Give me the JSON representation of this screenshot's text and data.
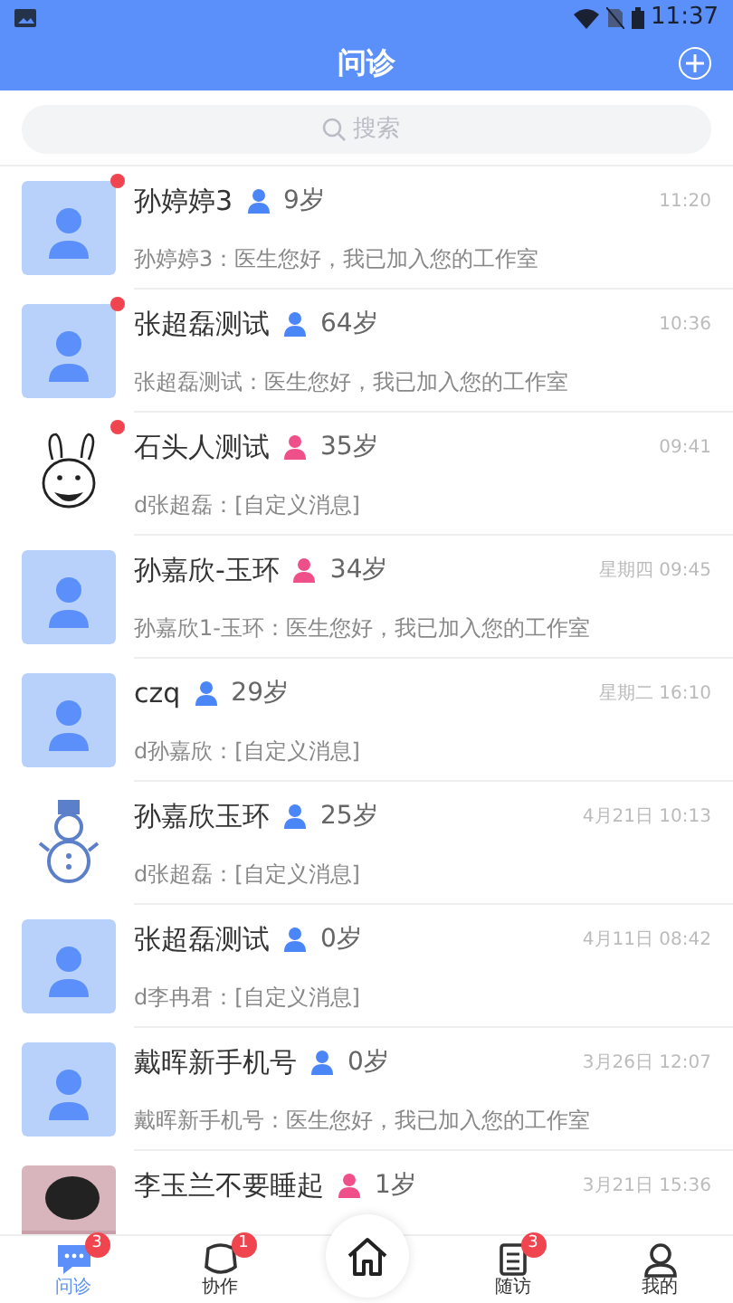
{
  "status_bar": {
    "time": "11:37"
  },
  "header": {
    "title": "问诊"
  },
  "search": {
    "placeholder": "搜索"
  },
  "conversations": [
    {
      "name": "孙婷婷3",
      "female": false,
      "age": "9岁",
      "time": "11:20",
      "message": "孙婷婷3：医生您好，我已加入您的工作室",
      "unread": true,
      "avatar": {
        "kind": "default"
      }
    },
    {
      "name": "张超磊测试",
      "female": false,
      "age": "64岁",
      "time": "10:36",
      "message": "张超磊测试：医生您好，我已加入您的工作室",
      "unread": true,
      "avatar": {
        "kind": "default"
      }
    },
    {
      "name": "石头人测试",
      "female": true,
      "age": "35岁",
      "time": "09:41",
      "message": "d张超磊：[自定义消息]",
      "unread": true,
      "avatar": {
        "kind": "cartoon"
      }
    },
    {
      "name": "孙嘉欣-玉环",
      "female": true,
      "age": "34岁",
      "time": "星期四 09:45",
      "message": "孙嘉欣1-玉环：医生您好，我已加入您的工作室",
      "unread": false,
      "avatar": {
        "kind": "default"
      }
    },
    {
      "name": "czq",
      "female": false,
      "age": "29岁",
      "time": "星期二 16:10",
      "message": "d孙嘉欣：[自定义消息]",
      "unread": false,
      "avatar": {
        "kind": "default"
      }
    },
    {
      "name": "孙嘉欣玉环",
      "female": false,
      "age": "25岁",
      "time": "4月21日 10:13",
      "message": "d张超磊：[自定义消息]",
      "unread": false,
      "avatar": {
        "kind": "snowman"
      }
    },
    {
      "name": "张超磊测试",
      "female": false,
      "age": "0岁",
      "time": "4月11日 08:42",
      "message": "d李冉君：[自定义消息]",
      "unread": false,
      "avatar": {
        "kind": "default"
      }
    },
    {
      "name": "戴晖新手机号",
      "female": false,
      "age": "0岁",
      "time": "3月26日 12:07",
      "message": "戴晖新手机号：医生您好，我已加入您的工作室",
      "unread": false,
      "avatar": {
        "kind": "default"
      }
    },
    {
      "name": "李玉兰不要睡起",
      "female": true,
      "age": "1岁",
      "time": "3月21日 15:36",
      "unread": false
    }
  ],
  "tab_bar": [
    {
      "kind": "chat",
      "label": "问诊",
      "badge": "3",
      "selected": true
    },
    {
      "kind": "collab",
      "label": "协作",
      "badge": "1",
      "selected": false
    },
    {
      "kind": "home",
      "selected": false
    },
    {
      "kind": "followup",
      "label": "随访",
      "badge": "3",
      "selected": false
    },
    {
      "kind": "me",
      "label": "我的",
      "selected": false
    }
  ]
}
